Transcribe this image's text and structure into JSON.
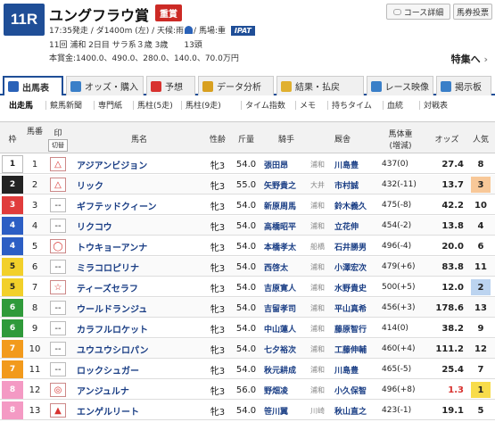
{
  "race": {
    "number": "11R",
    "name": "ユングフラウ賞",
    "grade": "重賞",
    "info1": "17:35発走 / ダ1400m (左) / 天候:雨",
    "weather_icon": "umbrella-icon",
    "info1b": "/ 馬場:重",
    "ipat": "IPAT",
    "info2": "11回 浦和 2日目 サラ系３歳 3歳　　13頭",
    "info3": "本賞金:1400.0、490.0、280.0、140.0、70.0万円"
  },
  "buttons": {
    "course": "コース詳細",
    "tohyo": "馬券投票",
    "tokusyu": "特集へ"
  },
  "tabs": [
    {
      "label": "出馬表",
      "color": "#2a62b8"
    },
    {
      "label": "オッズ・購入",
      "color": "#3a7fc8"
    },
    {
      "label": "予想",
      "color": "#d8322f"
    },
    {
      "label": "データ分析",
      "color": "#d8a020"
    },
    {
      "label": "結果・払戻",
      "color": "#e0b030"
    },
    {
      "label": "レース映像",
      "color": "#3a7fc8"
    },
    {
      "label": "掲示板",
      "color": "#3a7fc8"
    }
  ],
  "subtabs": [
    "出走馬",
    "競馬新聞",
    "専門紙",
    "馬柱(5走)",
    "馬柱(9走)",
    "タイム指数",
    "メモ",
    "持ちタイム",
    "血統",
    "対戦表"
  ],
  "headers": {
    "waku": "枠",
    "umaban": "馬番",
    "mark": "印",
    "mark_sub": "切替",
    "horse": "馬名",
    "sex": "性齢",
    "weight": "斤量",
    "jockey": "騎手",
    "trainer": "厩舎",
    "bw": "馬体重",
    "bw_sub": "(増減)",
    "odds": "オッズ",
    "ninki": "人気"
  },
  "horses": [
    {
      "waku": "1",
      "umaban": "1",
      "mark": "△",
      "name": "アジアンビジョン",
      "sex": "牝3",
      "kin": "54.0",
      "jockey": "張田昂",
      "aff": "浦和",
      "trainer": "川島豊",
      "bw": "437(0)",
      "odds": "27.4",
      "ninki": "8"
    },
    {
      "waku": "2",
      "umaban": "2",
      "mark": "△",
      "name": "リック",
      "sex": "牝3",
      "kin": "55.0",
      "jockey": "矢野貴之",
      "aff": "大井",
      "trainer": "市村誠",
      "bw": "432(-11)",
      "odds": "13.7",
      "ninki": "3"
    },
    {
      "waku": "3",
      "umaban": "3",
      "mark": "--",
      "name": "ギフテッドクィーン",
      "sex": "牝3",
      "kin": "54.0",
      "jockey": "新原周馬",
      "aff": "浦和",
      "trainer": "鈴木義久",
      "bw": "475(-8)",
      "odds": "42.2",
      "ninki": "10"
    },
    {
      "waku": "4",
      "umaban": "4",
      "mark": "--",
      "name": "リクコウ",
      "sex": "牝3",
      "kin": "54.0",
      "jockey": "高橋昭平",
      "aff": "浦和",
      "trainer": "立花伸",
      "bw": "454(-2)",
      "odds": "13.8",
      "ninki": "4"
    },
    {
      "waku": "4",
      "umaban": "5",
      "mark": "◯",
      "name": "トウキョーアンナ",
      "sex": "牝3",
      "kin": "54.0",
      "jockey": "本橋孝太",
      "aff": "船橋",
      "trainer": "石井勝男",
      "bw": "496(-4)",
      "odds": "20.0",
      "ninki": "6"
    },
    {
      "waku": "5",
      "umaban": "6",
      "mark": "--",
      "name": "ミラコロピリナ",
      "sex": "牝3",
      "kin": "54.0",
      "jockey": "西啓太",
      "aff": "浦和",
      "trainer": "小澤宏次",
      "bw": "479(+6)",
      "odds": "83.8",
      "ninki": "11"
    },
    {
      "waku": "5",
      "umaban": "7",
      "mark": "☆",
      "name": "ティーズセラフ",
      "sex": "牝3",
      "kin": "54.0",
      "jockey": "吉原寛人",
      "aff": "浦和",
      "trainer": "水野貴史",
      "bw": "500(+5)",
      "odds": "12.0",
      "ninki": "2"
    },
    {
      "waku": "6",
      "umaban": "8",
      "mark": "--",
      "name": "ウールドランジュ",
      "sex": "牝3",
      "kin": "54.0",
      "jockey": "吉留孝司",
      "aff": "浦和",
      "trainer": "平山真希",
      "bw": "456(+3)",
      "odds": "178.6",
      "ninki": "13"
    },
    {
      "waku": "6",
      "umaban": "9",
      "mark": "--",
      "name": "カラフルロケット",
      "sex": "牝3",
      "kin": "54.0",
      "jockey": "中山蓮人",
      "aff": "浦和",
      "trainer": "藤原智行",
      "bw": "414(0)",
      "odds": "38.2",
      "ninki": "9"
    },
    {
      "waku": "7",
      "umaban": "10",
      "mark": "--",
      "name": "ユウユウシロパン",
      "sex": "牝3",
      "kin": "54.0",
      "jockey": "七夕裕次",
      "aff": "浦和",
      "trainer": "工藤伸輔",
      "bw": "460(+4)",
      "odds": "111.2",
      "ninki": "12"
    },
    {
      "waku": "7",
      "umaban": "11",
      "mark": "--",
      "name": "ロックシュガー",
      "sex": "牝3",
      "kin": "54.0",
      "jockey": "秋元耕成",
      "aff": "浦和",
      "trainer": "川島豊",
      "bw": "465(-5)",
      "odds": "25.4",
      "ninki": "7"
    },
    {
      "waku": "8",
      "umaban": "12",
      "mark": "◎",
      "name": "アンジュルナ",
      "sex": "牝3",
      "kin": "56.0",
      "jockey": "野畑凌",
      "aff": "浦和",
      "trainer": "小久保智",
      "bw": "496(+8)",
      "odds": "1.3",
      "ninki": "1"
    },
    {
      "waku": "8",
      "umaban": "13",
      "mark": "▲",
      "name": "エンゲルリート",
      "sex": "牝3",
      "kin": "54.0",
      "jockey": "笹川翼",
      "aff": "川崎",
      "trainer": "秋山直之",
      "bw": "423(-1)",
      "odds": "19.1",
      "ninki": "5"
    }
  ],
  "colors": {
    "waku1": "#ffffff",
    "waku2": "#222222",
    "waku3": "#e03c3c",
    "waku4": "#2c5ec4",
    "waku5": "#f2d02a",
    "waku6": "#2f9a3a",
    "waku7": "#f29a1c",
    "waku8": "#f49ac4",
    "accent": "#1f4e97"
  }
}
